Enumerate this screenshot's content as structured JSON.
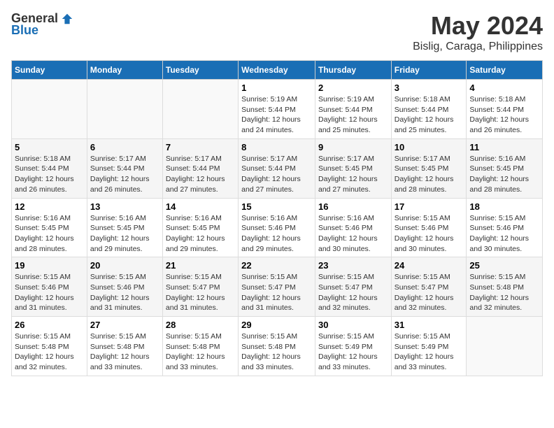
{
  "logo": {
    "general": "General",
    "blue": "Blue"
  },
  "title": "May 2024",
  "subtitle": "Bislig, Caraga, Philippines",
  "days_of_week": [
    "Sunday",
    "Monday",
    "Tuesday",
    "Wednesday",
    "Thursday",
    "Friday",
    "Saturday"
  ],
  "weeks": [
    [
      {
        "day": "",
        "detail": ""
      },
      {
        "day": "",
        "detail": ""
      },
      {
        "day": "",
        "detail": ""
      },
      {
        "day": "1",
        "detail": "Sunrise: 5:19 AM\nSunset: 5:44 PM\nDaylight: 12 hours\nand 24 minutes."
      },
      {
        "day": "2",
        "detail": "Sunrise: 5:19 AM\nSunset: 5:44 PM\nDaylight: 12 hours\nand 25 minutes."
      },
      {
        "day": "3",
        "detail": "Sunrise: 5:18 AM\nSunset: 5:44 PM\nDaylight: 12 hours\nand 25 minutes."
      },
      {
        "day": "4",
        "detail": "Sunrise: 5:18 AM\nSunset: 5:44 PM\nDaylight: 12 hours\nand 26 minutes."
      }
    ],
    [
      {
        "day": "5",
        "detail": "Sunrise: 5:18 AM\nSunset: 5:44 PM\nDaylight: 12 hours\nand 26 minutes."
      },
      {
        "day": "6",
        "detail": "Sunrise: 5:17 AM\nSunset: 5:44 PM\nDaylight: 12 hours\nand 26 minutes."
      },
      {
        "day": "7",
        "detail": "Sunrise: 5:17 AM\nSunset: 5:44 PM\nDaylight: 12 hours\nand 27 minutes."
      },
      {
        "day": "8",
        "detail": "Sunrise: 5:17 AM\nSunset: 5:44 PM\nDaylight: 12 hours\nand 27 minutes."
      },
      {
        "day": "9",
        "detail": "Sunrise: 5:17 AM\nSunset: 5:45 PM\nDaylight: 12 hours\nand 27 minutes."
      },
      {
        "day": "10",
        "detail": "Sunrise: 5:17 AM\nSunset: 5:45 PM\nDaylight: 12 hours\nand 28 minutes."
      },
      {
        "day": "11",
        "detail": "Sunrise: 5:16 AM\nSunset: 5:45 PM\nDaylight: 12 hours\nand 28 minutes."
      }
    ],
    [
      {
        "day": "12",
        "detail": "Sunrise: 5:16 AM\nSunset: 5:45 PM\nDaylight: 12 hours\nand 28 minutes."
      },
      {
        "day": "13",
        "detail": "Sunrise: 5:16 AM\nSunset: 5:45 PM\nDaylight: 12 hours\nand 29 minutes."
      },
      {
        "day": "14",
        "detail": "Sunrise: 5:16 AM\nSunset: 5:45 PM\nDaylight: 12 hours\nand 29 minutes."
      },
      {
        "day": "15",
        "detail": "Sunrise: 5:16 AM\nSunset: 5:46 PM\nDaylight: 12 hours\nand 29 minutes."
      },
      {
        "day": "16",
        "detail": "Sunrise: 5:16 AM\nSunset: 5:46 PM\nDaylight: 12 hours\nand 30 minutes."
      },
      {
        "day": "17",
        "detail": "Sunrise: 5:15 AM\nSunset: 5:46 PM\nDaylight: 12 hours\nand 30 minutes."
      },
      {
        "day": "18",
        "detail": "Sunrise: 5:15 AM\nSunset: 5:46 PM\nDaylight: 12 hours\nand 30 minutes."
      }
    ],
    [
      {
        "day": "19",
        "detail": "Sunrise: 5:15 AM\nSunset: 5:46 PM\nDaylight: 12 hours\nand 31 minutes."
      },
      {
        "day": "20",
        "detail": "Sunrise: 5:15 AM\nSunset: 5:46 PM\nDaylight: 12 hours\nand 31 minutes."
      },
      {
        "day": "21",
        "detail": "Sunrise: 5:15 AM\nSunset: 5:47 PM\nDaylight: 12 hours\nand 31 minutes."
      },
      {
        "day": "22",
        "detail": "Sunrise: 5:15 AM\nSunset: 5:47 PM\nDaylight: 12 hours\nand 31 minutes."
      },
      {
        "day": "23",
        "detail": "Sunrise: 5:15 AM\nSunset: 5:47 PM\nDaylight: 12 hours\nand 32 minutes."
      },
      {
        "day": "24",
        "detail": "Sunrise: 5:15 AM\nSunset: 5:47 PM\nDaylight: 12 hours\nand 32 minutes."
      },
      {
        "day": "25",
        "detail": "Sunrise: 5:15 AM\nSunset: 5:48 PM\nDaylight: 12 hours\nand 32 minutes."
      }
    ],
    [
      {
        "day": "26",
        "detail": "Sunrise: 5:15 AM\nSunset: 5:48 PM\nDaylight: 12 hours\nand 32 minutes."
      },
      {
        "day": "27",
        "detail": "Sunrise: 5:15 AM\nSunset: 5:48 PM\nDaylight: 12 hours\nand 33 minutes."
      },
      {
        "day": "28",
        "detail": "Sunrise: 5:15 AM\nSunset: 5:48 PM\nDaylight: 12 hours\nand 33 minutes."
      },
      {
        "day": "29",
        "detail": "Sunrise: 5:15 AM\nSunset: 5:48 PM\nDaylight: 12 hours\nand 33 minutes."
      },
      {
        "day": "30",
        "detail": "Sunrise: 5:15 AM\nSunset: 5:49 PM\nDaylight: 12 hours\nand 33 minutes."
      },
      {
        "day": "31",
        "detail": "Sunrise: 5:15 AM\nSunset: 5:49 PM\nDaylight: 12 hours\nand 33 minutes."
      },
      {
        "day": "",
        "detail": ""
      }
    ]
  ]
}
